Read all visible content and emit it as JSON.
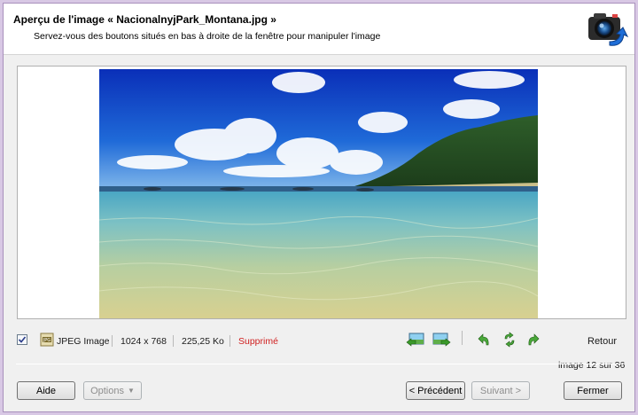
{
  "header": {
    "title": "Aperçu de l'image « NacionalnyjPark_Montana.jpg »",
    "subtitle": "Servez-vous des boutons situés en bas à droite de la fenêtre pour manipuler l'image",
    "icon": "camera-icon"
  },
  "preview": {
    "image": "beach-photo"
  },
  "info": {
    "checked": true,
    "type": "JPEG Image",
    "dimensions": "1024 x 768",
    "size": "225,25 Ko",
    "status": "Supprimé",
    "status_color": "#d02020"
  },
  "tools": {
    "prev_icon": "previous-image-icon",
    "next_icon": "next-image-icon",
    "rotate_left_icon": "rotate-left-icon",
    "flip_icon": "flip-icon",
    "rotate_right_icon": "rotate-right-icon",
    "back_label": "Retour"
  },
  "counter": "image 12 sur 36",
  "buttons": {
    "help": "Aide",
    "options": "Options",
    "previous": "< Précédent",
    "next": "Suivant >",
    "close": "Fermer"
  }
}
